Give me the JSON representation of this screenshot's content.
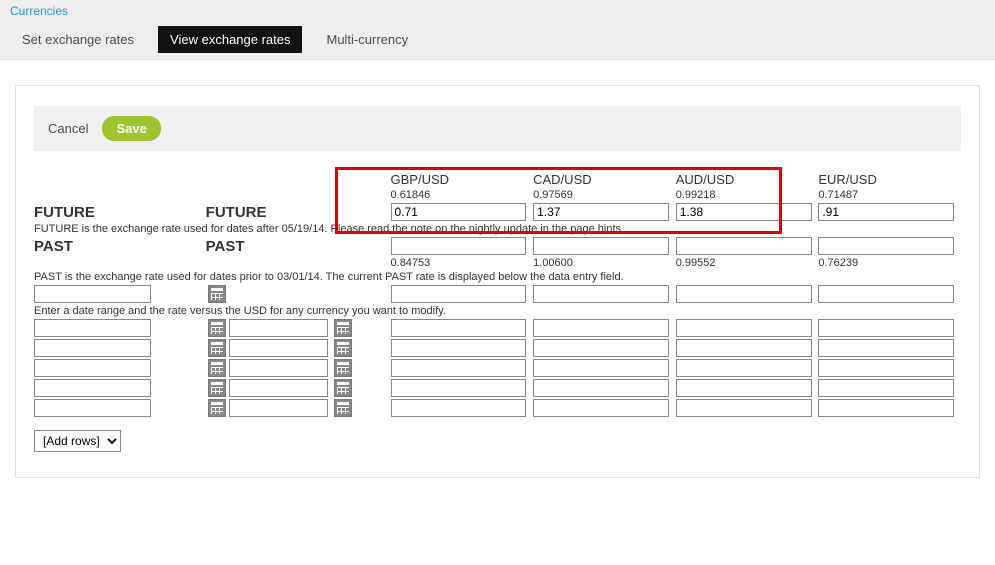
{
  "breadcrumb": {
    "currencies": "Currencies"
  },
  "tabs": {
    "set": "Set exchange rates",
    "view": "View exchange rates",
    "multi": "Multi-currency"
  },
  "actions": {
    "cancel": "Cancel",
    "save": "Save"
  },
  "pairs": [
    {
      "label": "GBP/USD",
      "rate": "0.61846",
      "future": "0.71",
      "past": "0.84753"
    },
    {
      "label": "CAD/USD",
      "rate": "0.97569",
      "future": "1.37",
      "past": "1.00600"
    },
    {
      "label": "AUD/USD",
      "rate": "0.99218",
      "future": "1.38",
      "past": "0.99552"
    },
    {
      "label": "EUR/USD",
      "rate": "0.71487",
      "future": ".91",
      "past": "0.76239"
    }
  ],
  "labels": {
    "future1": "FUTURE",
    "future2": "FUTURE",
    "past1": "PAST",
    "past2": "PAST"
  },
  "hints": {
    "future": "FUTURE is the exchange rate used for dates after 05/19/14. Please read the note on the nightly update in the page hints.",
    "past": "PAST is the exchange rate used for dates prior to 03/01/14. The current PAST rate is displayed below the data entry field.",
    "range": "Enter a date range and the rate versus the USD for any currency you want to modify."
  },
  "addrows": {
    "label": "[Add rows]"
  }
}
